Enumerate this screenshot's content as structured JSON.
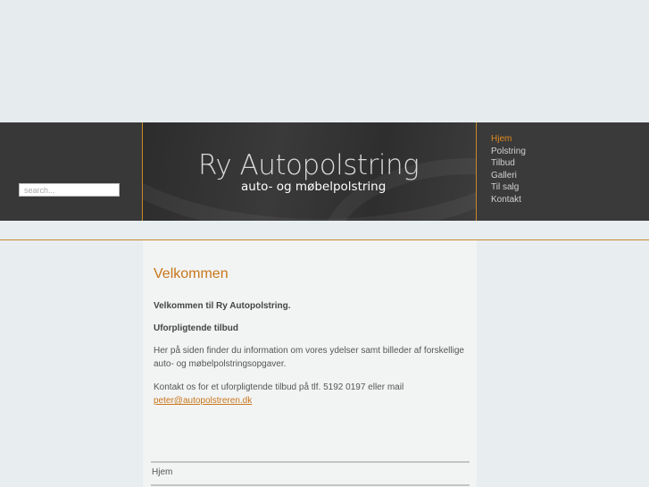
{
  "header": {
    "search_placeholder": "search...",
    "logo_title": "Ry Autopolstring",
    "logo_subtitle": "auto- og møbelpolstring"
  },
  "nav": {
    "items": [
      {
        "label": "Hjem",
        "active": true
      },
      {
        "label": "Polstring",
        "active": false
      },
      {
        "label": "Tilbud",
        "active": false
      },
      {
        "label": "Galleri",
        "active": false
      },
      {
        "label": "Til salg",
        "active": false
      },
      {
        "label": "Kontakt",
        "active": false
      }
    ]
  },
  "content": {
    "heading": "Velkommen",
    "intro": "Velkommen til Ry Autopolstring.",
    "subheading": "Uforpligtende tilbud",
    "body": "Her på siden finder du information om vores ydelser samt billeder af forskellige auto- og møbelpolstringsopgaver.",
    "contact_text": "Kontakt os for et uforpligtende tilbud på tlf. 5192 0197 eller mail",
    "email": "peter@autopolstreren.dk"
  },
  "footer": {
    "link": "Hjem"
  },
  "colors": {
    "accent": "#c8761a",
    "active_nav": "#e08a1f",
    "header_bg": "#353535"
  }
}
